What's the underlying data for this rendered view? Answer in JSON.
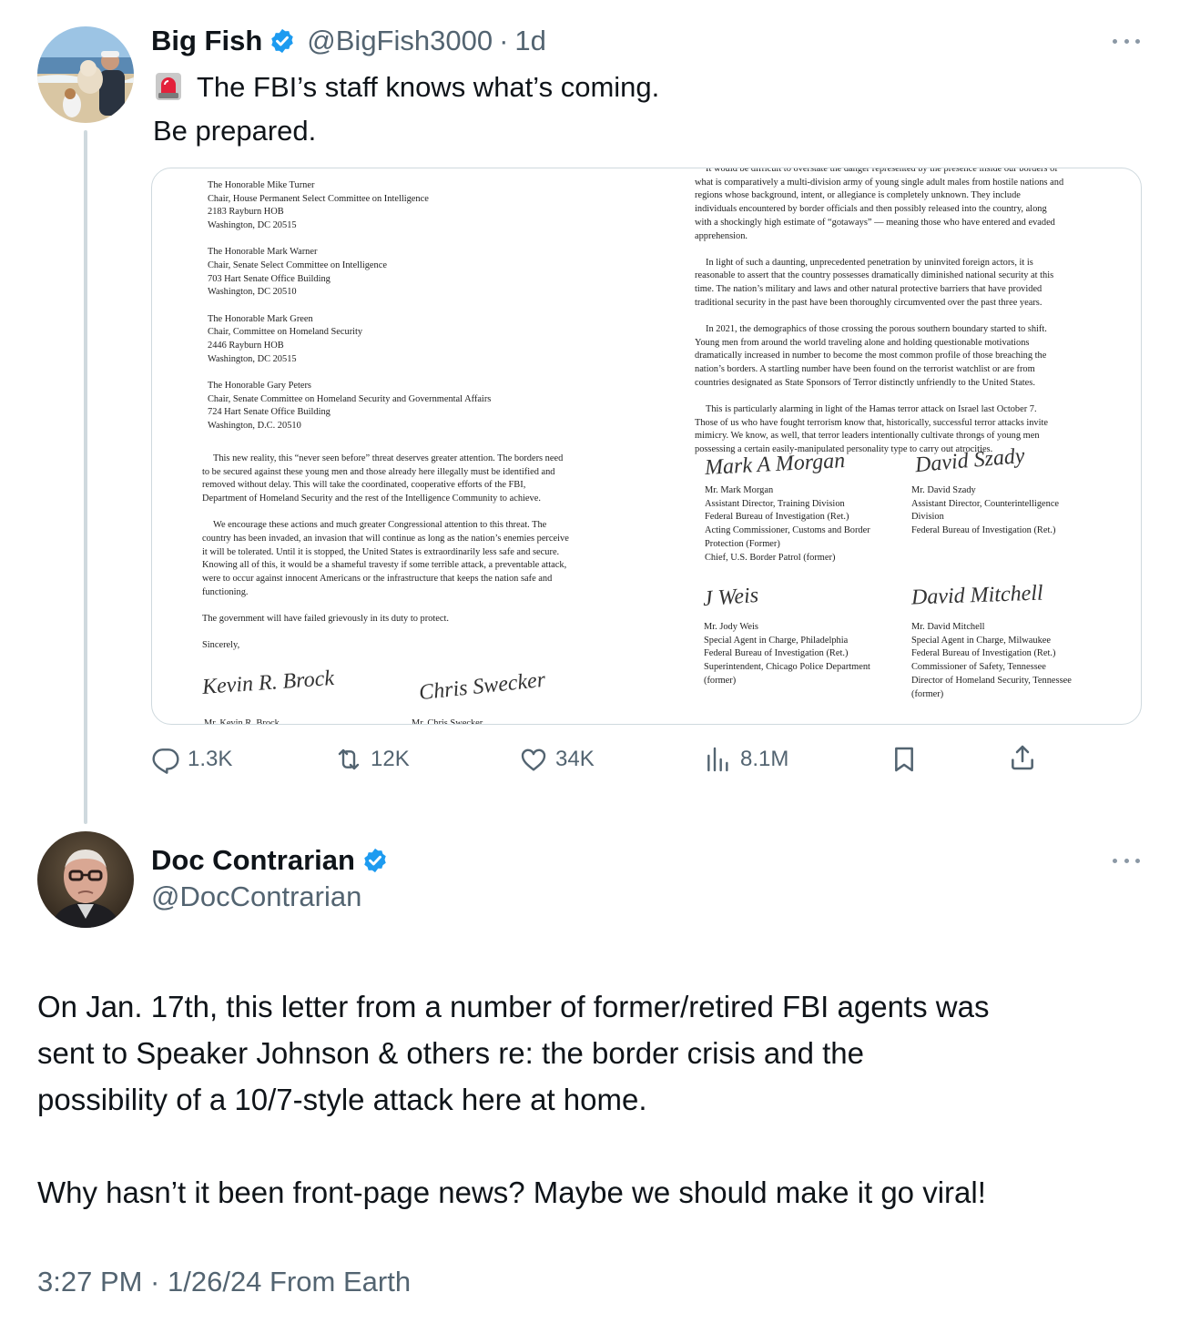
{
  "tweet1": {
    "display_name": "Big Fish",
    "handle": "@BigFish3000",
    "separator": "·",
    "time": "1d",
    "text_line1": "The FBI’s staff knows what’s coming.",
    "text_line2": "Be prepared.",
    "emoji": "rotating-light-icon",
    "actions": {
      "replies": "1.3K",
      "retweets": "12K",
      "likes": "34K",
      "views": "8.1M"
    }
  },
  "letter": {
    "addressees": [
      [
        "The Honorable Mike Turner",
        "Chair, House Permanent Select Committee on Intelligence",
        "2183 Rayburn HOB",
        "Washington, DC 20515"
      ],
      [
        "The Honorable Mark Warner",
        "Chair, Senate Select Committee on Intelligence",
        "703 Hart Senate Office Building",
        "Washington, DC 20510"
      ],
      [
        "The Honorable Mark Green",
        "Chair, Committee on Homeland Security",
        "2446 Rayburn HOB",
        "Washington, DC 20515"
      ],
      [
        "The Honorable Gary Peters",
        "Chair, Senate Committee on Homeland Security and Governmental Affairs",
        "724 Hart Senate Office Building",
        "Washington, D.C. 20510"
      ]
    ],
    "left_paragraphs": [
      [
        "This new reality, this “never seen before” threat deserves greater attention.  The borders need",
        "to be secured against these young men and those already here illegally must be identified and",
        "removed without delay.  This will take the coordinated, cooperative efforts of the FBI,",
        "Department of Homeland Security and the rest of the Intelligence Community to achieve."
      ],
      [
        "We encourage these actions and much greater Congressional attention to this threat. The",
        "country has been invaded, an invasion that will continue as long as the nation’s enemies perceive",
        "it will be tolerated.  Until it is stopped, the United States is extraordinarily less safe and secure.",
        "Knowing all of this, it would be a shameful travesty if some terrible attack, a preventable attack,",
        "were to occur against innocent Americans or the infrastructure that keeps the nation safe and",
        "functioning."
      ],
      [
        "The government will have failed grievously in its duty to protect."
      ],
      [
        "Sincerely,"
      ]
    ],
    "right_paragraphs": [
      [
        "It would be difficult to overstate the danger represented by the presence inside our borders of",
        "what is comparatively a multi-division army of young single adult males from hostile nations and",
        "regions whose background, intent, or allegiance is completely unknown.  They include",
        "individuals encountered by border officials and then possibly released into the country, along",
        "with a shockingly high estimate of “gotaways” — meaning those who have entered and evaded",
        "apprehension."
      ],
      [
        "In light of such a daunting, unprecedented penetration by uninvited foreign actors, it is",
        "reasonable to assert that the country possesses dramatically diminished national security at this",
        "time.  The nation’s military and laws and other natural protective barriers that have provided",
        "traditional security in the past have been thoroughly circumvented over the past three years."
      ],
      [
        "In 2021, the demographics of those crossing the porous southern boundary started to shift.",
        "Young men from around the world traveling alone and holding questionable motivations",
        "dramatically increased in number to become the most common profile of those breaching the",
        "nation’s borders.  A startling number have been found on the terrorist watchlist or are from",
        "countries designated as State Sponsors of Terror distinctly unfriendly to the United States."
      ],
      [
        "This is particularly alarming in light of the Hamas terror attack on Israel last October 7.",
        "Those of us who have fought terrorism know that, historically, successful terror attacks invite",
        "mimicry.  We know, as well, that terror leaders intentionally cultivate throngs of young men",
        "possessing a certain easily-manipulated personality type to carry out atrocities."
      ]
    ],
    "signers": [
      {
        "signature": "Mark A Morgan",
        "lines": [
          "Mr. Mark Morgan",
          "Assistant Director, Training Division",
          "Federal Bureau of Investigation (Ret.)",
          "Acting Commissioner, Customs and Border",
          "Protection (Former)",
          "Chief, U.S. Border Patrol (former)"
        ]
      },
      {
        "signature": "David Szady",
        "lines": [
          "Mr. David Szady",
          "Assistant Director, Counterintelligence",
          "Division",
          "Federal Bureau of Investigation (Ret.)"
        ]
      },
      {
        "signature": "J Weis",
        "lines": [
          "Mr. Jody Weis",
          "Special Agent in Charge, Philadelphia",
          "Federal Bureau of Investigation (Ret.)",
          "Superintendent, Chicago Police Department",
          "(former)"
        ]
      },
      {
        "signature": "David Mitchell",
        "lines": [
          "Mr. David Mitchell",
          "Special Agent in Charge, Milwaukee",
          "Federal Bureau of Investigation (Ret.)",
          "Commissioner of Safety, Tennessee",
          "Director of Homeland Security, Tennessee",
          "(former)"
        ]
      }
    ],
    "bottom_signatures": [
      "Kevin R. Brock",
      "Chris Swecker"
    ],
    "bottom_names": [
      "Mr. Kevin R. Brock",
      "Mr. Chris Swecker"
    ]
  },
  "tweet2": {
    "display_name": "Doc Contrarian",
    "handle": "@DocContrarian",
    "text_line1": "On Jan. 17th, this letter from a number of former/retired FBI agents was",
    "text_line2": "sent to Speaker Johnson & others re: the border crisis and the",
    "text_line3": "possibility of a 10/7-style attack here at home.",
    "text_line4": "Why hasn’t it been front-page news? Maybe we should make it go viral!",
    "timestamp": "3:27 PM · 1/26/24 From Earth"
  },
  "colors": {
    "verified_blue": "#1d9bf0",
    "text_primary": "#0f1419",
    "text_secondary": "#536471",
    "divider": "#cfd9de"
  }
}
